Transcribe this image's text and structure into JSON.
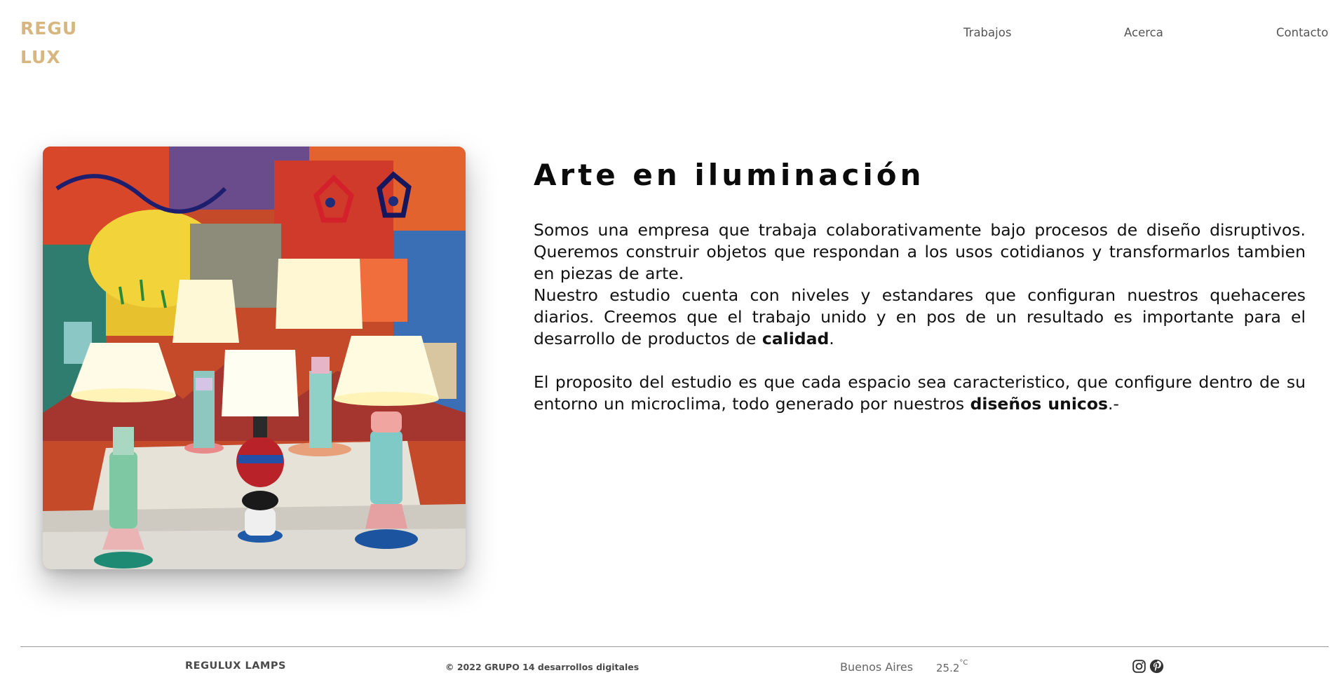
{
  "header": {
    "logo_line1": "REGU",
    "logo_line2": "LUX",
    "nav": [
      {
        "label": "Trabajos"
      },
      {
        "label": "Acerca"
      },
      {
        "label": "Contacto"
      }
    ]
  },
  "main": {
    "title": "Arte en iluminación",
    "intro_1": "Somos una empresa que trabaja colaborativamente bajo procesos de diseño disruptivos. Queremos construir objetos que respondan a los usos cotidianos y transformarlos tambien en piezas de arte.",
    "intro_2": "Nuestro estudio cuenta con niveles y estandares que configuran nuestros quehaceres diarios. Creemos que el trabajo unido y en pos de un resultado es importante para el desarrollo de productos de",
    "intro_2_bold": "calidad",
    "intro_2_end": ".",
    "purpose": "El proposito del estudio es que cada espacio sea caracteristico, que configure dentro de su entorno un microclima, todo generado por nuestros",
    "purpose_bold": "diseños unicos",
    "purpose_end": ".-"
  },
  "footer": {
    "brand": "REGULUX LAMPS",
    "copyright": "© 2022 GRUPO 14 desarrollos digitales",
    "city": "Buenos Aires",
    "temperature": "25.2",
    "temperature_unit": "°C",
    "social_icons": [
      "instagram-icon",
      "pinterest-icon"
    ]
  },
  "colors": {
    "logo": "#d7b77f",
    "text": "#111111",
    "nav": "#555555",
    "footer_text": "#4a4a4a"
  }
}
